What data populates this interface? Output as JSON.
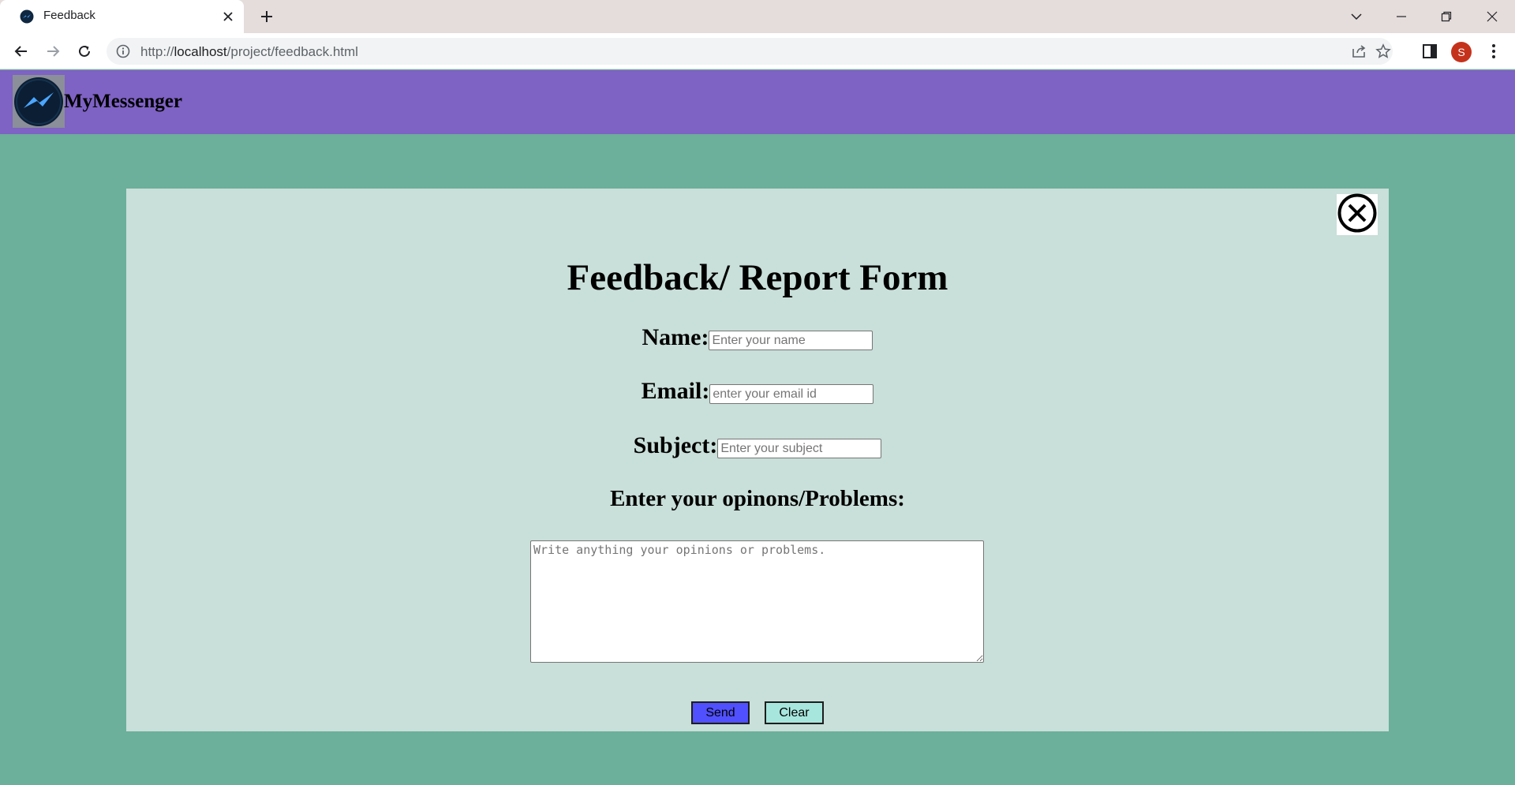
{
  "browser": {
    "tab_title": "Feedback",
    "url_prefix": "http://",
    "url_host": "localhost",
    "url_path": "/project/feedback.html",
    "profile_initial": "S",
    "profile_color": "#c5321c"
  },
  "site": {
    "title": "MyMessenger",
    "header_color": "#7e62c4",
    "background_color": "#6caf9a"
  },
  "form": {
    "title": "Feedback/ Report Form",
    "name_label": "Name:",
    "name_placeholder": "Enter your name",
    "email_label": "Email:",
    "email_placeholder": "enter your email id",
    "subject_label": "Subject:",
    "subject_placeholder": "Enter your subject",
    "opinions_label": "Enter your opinons/Problems:",
    "opinions_placeholder": "Write anything your opinions or problems.",
    "send_label": "Send",
    "clear_label": "Clear",
    "panel_color": "#c9dfd9",
    "send_color": "#5050ff",
    "clear_color": "#a7e6dd"
  },
  "icons": {
    "tab_favicon": "messenger-logo-icon",
    "close_form": "close-circle-icon"
  }
}
